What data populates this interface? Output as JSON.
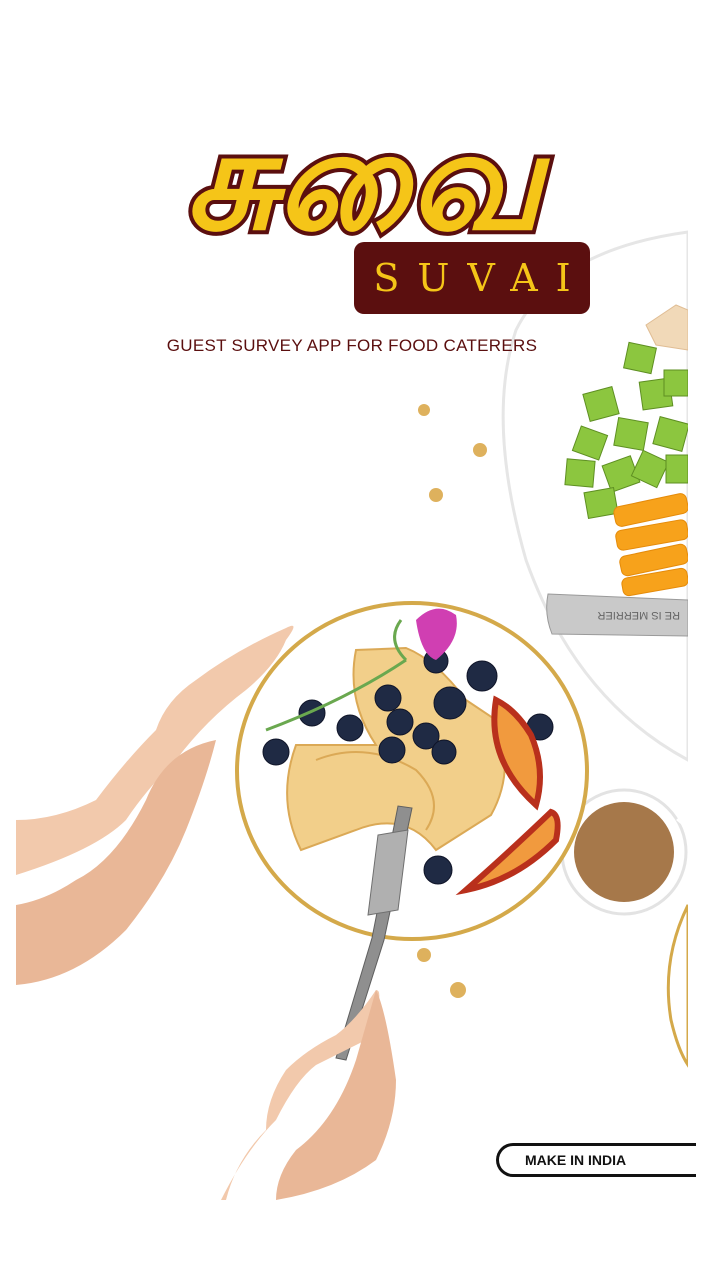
{
  "brand": {
    "tamil_name": "சுவை",
    "name": "SUVAI",
    "tagline": "GUEST SURVEY APP FOR FOOD CATERERS",
    "badge": "MAKE IN INDIA",
    "colors": {
      "logo_yellow": "#f5c518",
      "logo_maroon": "#5b0f0f",
      "background": "#ffffff"
    }
  },
  "photo": {
    "knife_engraving": "RE IS MERRIER"
  }
}
